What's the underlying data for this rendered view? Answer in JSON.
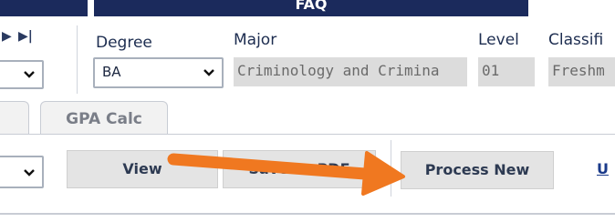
{
  "banner": {
    "title": "FAQ"
  },
  "nav": {
    "next_glyph": "▶",
    "last_glyph": "▶|"
  },
  "fields": {
    "degree": {
      "label": "Degree",
      "value": "BA"
    },
    "major": {
      "label": "Major",
      "value": "Criminology and Crimina"
    },
    "level": {
      "label": "Level",
      "value": "01"
    },
    "classification": {
      "label": "Classifi",
      "value": "Freshm"
    }
  },
  "tabs": [
    {
      "label": ""
    },
    {
      "label": "GPA Calc"
    }
  ],
  "toolbar": {
    "view_label": "View",
    "save_pdf_label": "Save as PDF",
    "process_new_label": "Process New",
    "link_label": "U"
  },
  "colors": {
    "banner": "#1b2a5c",
    "arrow": "#f07820",
    "link": "#1a3a8a"
  }
}
